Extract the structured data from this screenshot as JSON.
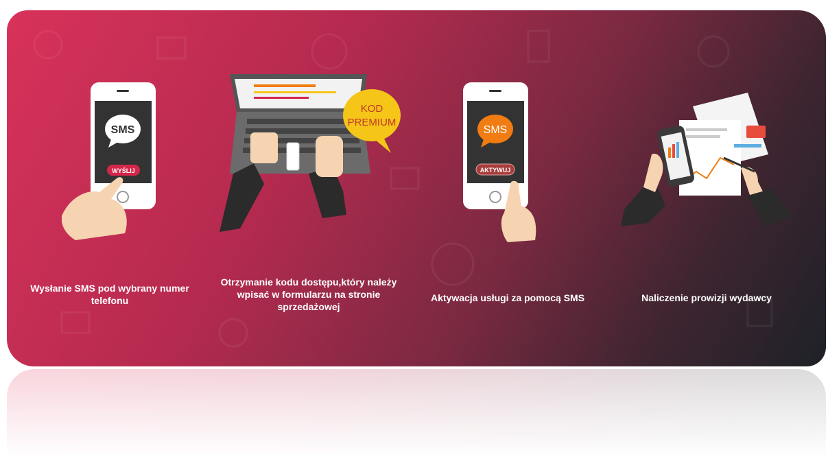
{
  "steps": [
    {
      "caption": "Wysłanie SMS pod wybrany numer telefonu",
      "bubble": "SMS",
      "button": "WYŚLIJ"
    },
    {
      "caption": "Otrzymanie kodu dostępu,który należy wpisać w formularzu na stronie sprzedażowej",
      "bubble_line1": "KOD",
      "bubble_line2": "PREMIUM"
    },
    {
      "caption": "Aktywacja usługi za pomocą SMS",
      "bubble": "SMS",
      "button": "AKTYWUJ"
    },
    {
      "caption": "Naliczenie prowizji wydawcy"
    }
  ],
  "colors": {
    "gradient_start": "#d8325a",
    "gradient_end": "#1e2128",
    "bubble_orange": "#f07c12",
    "bubble_yellow": "#f5c518",
    "button_red": "#d4264a"
  },
  "icons": [
    "phone-sms-send-icon",
    "laptop-premium-code-icon",
    "phone-sms-activate-icon",
    "commission-documents-icon"
  ]
}
